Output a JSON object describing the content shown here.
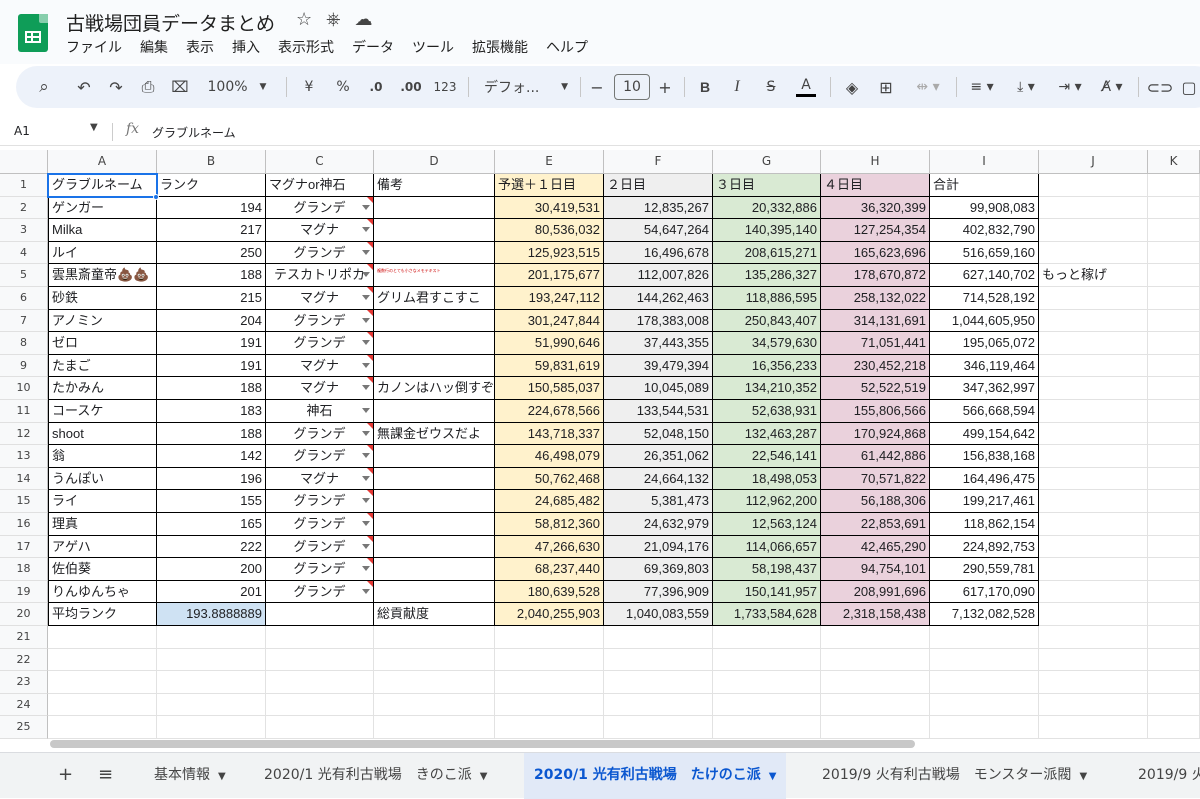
{
  "document": {
    "title": "古戦場団員データまとめ",
    "icons": [
      "star-icon",
      "move-to-drive-icon",
      "cloud-status-icon"
    ]
  },
  "menu": [
    "ファイル",
    "編集",
    "表示",
    "挿入",
    "表示形式",
    "データ",
    "ツール",
    "拡張機能",
    "ヘルプ"
  ],
  "toolbar": {
    "zoom": "100%",
    "currency": "¥",
    "percent": "%",
    "dec_decrease": ".0",
    "dec_increase": ".00",
    "format_123": "123",
    "font": "デフォ...",
    "minus": "−",
    "font_size": "10",
    "plus": "+",
    "bold": "B",
    "italic": "I",
    "strike": "S",
    "text_color": "A"
  },
  "formula_bar": {
    "cell_ref": "A1",
    "fx": "fx",
    "value": "グラブルネーム"
  },
  "columns": [
    "A",
    "B",
    "C",
    "D",
    "E",
    "F",
    "G",
    "H",
    "I",
    "J",
    "K"
  ],
  "rows_visible": [
    "1",
    "2",
    "3",
    "4",
    "5",
    "6",
    "7",
    "8",
    "9",
    "10",
    "11",
    "12",
    "13",
    "14",
    "15",
    "16",
    "17",
    "18",
    "19",
    "20",
    "21",
    "22",
    "23",
    "24",
    "25"
  ],
  "header_row": {
    "name": "グラブルネーム",
    "rank": "ランク",
    "type": "マグナor神石",
    "note": "備考",
    "day1": "予選＋１日目",
    "day2": "２日目",
    "day3": "３日目",
    "day4": "４日目",
    "total": "合計"
  },
  "members": [
    {
      "name": "ゲンガー",
      "rank": "194",
      "type": "グランデ",
      "note": "",
      "day1": "30,419,531",
      "day2": "12,835,267",
      "day3": "20,332,886",
      "day4": "36,320,399",
      "total": "99,908,083",
      "extra": ""
    },
    {
      "name": "Milka",
      "rank": "217",
      "type": "マグナ",
      "note": "",
      "day1": "80,536,032",
      "day2": "54,647,264",
      "day3": "140,395,140",
      "day4": "127,254,354",
      "total": "402,832,790",
      "extra": ""
    },
    {
      "name": "ルイ",
      "rank": "250",
      "type": "グランデ",
      "note": "",
      "day1": "125,923,515",
      "day2": "16,496,678",
      "day3": "208,615,271",
      "day4": "165,623,696",
      "total": "516,659,160",
      "extra": ""
    },
    {
      "name": "雲黒斎童帝💩💩",
      "rank": "188",
      "type": "テスカトリポカ",
      "note": "複数行のとても小さなメモテキスト",
      "day1": "201,175,677",
      "day2": "112,007,826",
      "day3": "135,286,327",
      "day4": "178,670,872",
      "total": "627,140,702",
      "extra": "もっと稼げ"
    },
    {
      "name": "砂鉄",
      "rank": "215",
      "type": "マグナ",
      "note": "グリム君すこすこ",
      "day1": "193,247,112",
      "day2": "144,262,463",
      "day3": "118,886,595",
      "day4": "258,132,022",
      "total": "714,528,192",
      "extra": ""
    },
    {
      "name": "アノミン",
      "rank": "204",
      "type": "グランデ",
      "note": "",
      "day1": "301,247,844",
      "day2": "178,383,008",
      "day3": "250,843,407",
      "day4": "314,131,691",
      "total": "1,044,605,950",
      "extra": ""
    },
    {
      "name": "ゼロ",
      "rank": "191",
      "type": "グランデ",
      "note": "",
      "day1": "51,990,646",
      "day2": "37,443,355",
      "day3": "34,579,630",
      "day4": "71,051,441",
      "total": "195,065,072",
      "extra": ""
    },
    {
      "name": "たまご",
      "rank": "191",
      "type": "マグナ",
      "note": "",
      "day1": "59,831,619",
      "day2": "39,479,394",
      "day3": "16,356,233",
      "day4": "230,452,218",
      "total": "346,119,464",
      "extra": ""
    },
    {
      "name": "たかみん",
      "rank": "188",
      "type": "マグナ",
      "note": "カノンはハッ倒すぞ",
      "day1": "150,585,037",
      "day2": "10,045,089",
      "day3": "134,210,352",
      "day4": "52,522,519",
      "total": "347,362,997",
      "extra": ""
    },
    {
      "name": "コースケ",
      "rank": "183",
      "type": "神石",
      "note": "",
      "day1": "224,678,566",
      "day2": "133,544,531",
      "day3": "52,638,931",
      "day4": "155,806,566",
      "total": "566,668,594",
      "extra": ""
    },
    {
      "name": "shoot",
      "rank": "188",
      "type": "グランデ",
      "note": "無課金ゼウスだよ",
      "day1": "143,718,337",
      "day2": "52,048,150",
      "day3": "132,463,287",
      "day4": "170,924,868",
      "total": "499,154,642",
      "extra": ""
    },
    {
      "name": "翁",
      "rank": "142",
      "type": "グランデ",
      "note": "",
      "day1": "46,498,079",
      "day2": "26,351,062",
      "day3": "22,546,141",
      "day4": "61,442,886",
      "total": "156,838,168",
      "extra": ""
    },
    {
      "name": "うんぽい",
      "rank": "196",
      "type": "マグナ",
      "note": "",
      "day1": "50,762,468",
      "day2": "24,664,132",
      "day3": "18,498,053",
      "day4": "70,571,822",
      "total": "164,496,475",
      "extra": ""
    },
    {
      "name": "ライ",
      "rank": "155",
      "type": "グランデ",
      "note": "",
      "day1": "24,685,482",
      "day2": "5,381,473",
      "day3": "112,962,200",
      "day4": "56,188,306",
      "total": "199,217,461",
      "extra": ""
    },
    {
      "name": "理真",
      "rank": "165",
      "type": "グランデ",
      "note": "",
      "day1": "58,812,360",
      "day2": "24,632,979",
      "day3": "12,563,124",
      "day4": "22,853,691",
      "total": "118,862,154",
      "extra": ""
    },
    {
      "name": "アゲハ",
      "rank": "222",
      "type": "グランデ",
      "note": "",
      "day1": "47,266,630",
      "day2": "21,094,176",
      "day3": "114,066,657",
      "day4": "42,465,290",
      "total": "224,892,753",
      "extra": ""
    },
    {
      "name": "佐伯葵",
      "rank": "200",
      "type": "グランデ",
      "note": "",
      "day1": "68,237,440",
      "day2": "69,369,803",
      "day3": "58,198,437",
      "day4": "94,754,101",
      "total": "290,559,781",
      "extra": ""
    },
    {
      "name": "りんゆんちゃ",
      "rank": "201",
      "type": "グランデ",
      "note": "",
      "day1": "180,639,528",
      "day2": "77,396,909",
      "day3": "150,141,957",
      "day4": "208,991,696",
      "total": "617,170,090",
      "extra": ""
    }
  ],
  "summary_row": {
    "label": "平均ランク",
    "avg_rank": "193.8888889",
    "contrib_label": "総貢献度",
    "day1": "2,040,255,903",
    "day2": "1,040,083,559",
    "day3": "1,733,584,628",
    "day4": "2,318,158,438",
    "total": "7,132,082,528"
  },
  "colors": {
    "day1_bg": "#fff2cc",
    "day2_bg": "#efefef",
    "day3_bg": "#d9ead3",
    "day4_bg": "#ead1dc",
    "avg_bg": "#cfe2f3",
    "accent": "#1a73e8"
  },
  "sheet_tabs": {
    "add": "+",
    "list": "≡",
    "tabs": [
      {
        "label": "基本情報",
        "active": false
      },
      {
        "label": "2020/1 光有利古戦場　きのこ派",
        "active": false
      },
      {
        "label": "2020/1 光有利古戦場　たけのこ派",
        "active": true
      },
      {
        "label": "2019/9 火有利古戦場　モンスター派閥",
        "active": false
      },
      {
        "label": "2019/9 火",
        "active": false
      }
    ]
  }
}
